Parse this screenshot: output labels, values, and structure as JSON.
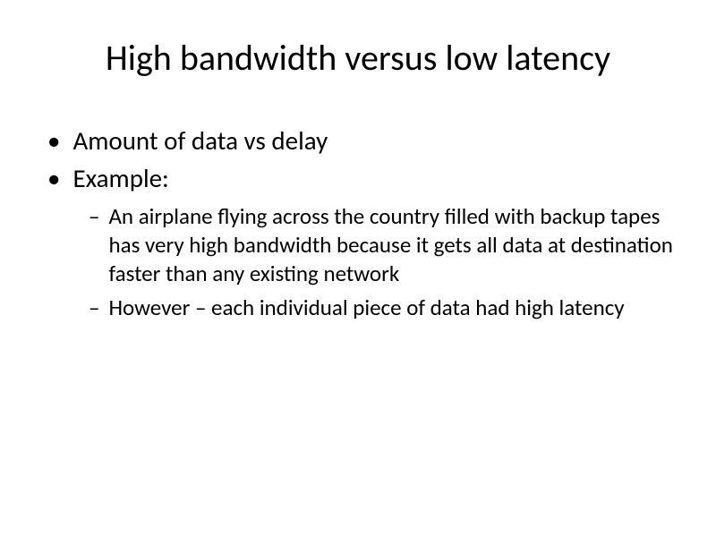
{
  "title": "High bandwidth versus low latency",
  "bullets": {
    "level1": [
      "Amount of data vs delay",
      "Example:"
    ],
    "level2": [
      "An airplane flying across the country filled with backup tapes has very high bandwidth because it gets all data at destination faster than any existing network",
      "However – each individual piece of data had high latency"
    ]
  }
}
